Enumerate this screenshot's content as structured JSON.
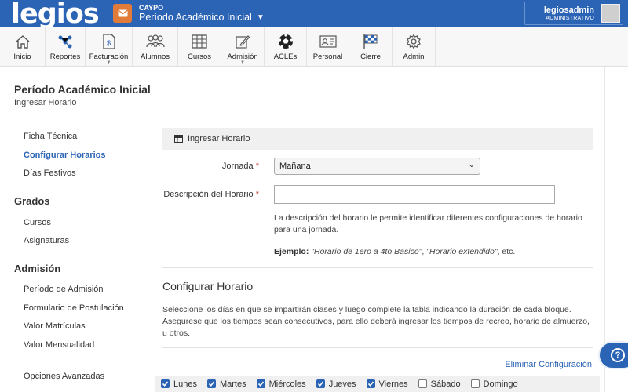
{
  "header": {
    "logo": "legios",
    "org_code": "CAYPO",
    "period": "Período Académico Inicial",
    "user_name": "legiosadmin",
    "user_role": "ADMINISTRATIVO"
  },
  "nav": {
    "items": [
      {
        "label": "Inicio",
        "icon": "home-icon"
      },
      {
        "label": "Reportes",
        "icon": "network-icon"
      },
      {
        "label": "Facturación",
        "icon": "invoice-icon"
      },
      {
        "label": "Alumnos",
        "icon": "students-icon"
      },
      {
        "label": "Cursos",
        "icon": "grid-icon"
      },
      {
        "label": "Admisión",
        "icon": "pencil-icon"
      },
      {
        "label": "ACLEs",
        "icon": "soccer-ball-icon"
      },
      {
        "label": "Personal",
        "icon": "id-card-icon"
      },
      {
        "label": "Cierre",
        "icon": "checkered-flag-icon"
      },
      {
        "label": "Admin",
        "icon": "gear-icon"
      }
    ]
  },
  "page": {
    "title": "Período Académico Inicial",
    "subtitle": "Ingresar Horario"
  },
  "sidebar": {
    "links_top": [
      "Ficha Técnica",
      "Configurar Horarios",
      "Días Festivos"
    ],
    "section_grados": "Grados",
    "links_grados": [
      "Cursos",
      "Asignaturas"
    ],
    "section_admision": "Admisión",
    "links_admision": [
      "Período de Admisión",
      "Formulario de Postulación",
      "Valor Matrículas",
      "Valor Mensualidad"
    ],
    "link_advanced": "Opciones Avanzadas"
  },
  "form": {
    "header": "Ingresar Horario",
    "jornada_label": "Jornada",
    "jornada_value": "Mañana",
    "descripcion_label": "Descripción del Horario",
    "required_mark": "*",
    "descripcion_value": "",
    "help": "La descripción del horario le permite identificar diferentes configuraciones de horario para una jornada.",
    "example_label": "Ejemplo:",
    "example_a": "\"Horario de 1ero a 4to Básico\"",
    "example_sep": ", ",
    "example_b": "\"Horario extendido\"",
    "example_tail": ", etc."
  },
  "config": {
    "title": "Configurar Horario",
    "desc": "Seleccione los días en que se impartirán clases y luego complete la tabla indicando la duración de cada bloque. Asegurese que los tiempos sean consecutivos, para ello deberá ingresar los tiempos de recreo, horario de almuerzo, u otros.",
    "delete_link": "Eliminar Configuración",
    "days": [
      {
        "label": "Lunes",
        "checked": true
      },
      {
        "label": "Martes",
        "checked": true
      },
      {
        "label": "Miércoles",
        "checked": true
      },
      {
        "label": "Jueves",
        "checked": true
      },
      {
        "label": "Viernes",
        "checked": true
      },
      {
        "label": "Sábado",
        "checked": false
      },
      {
        "label": "Domingo",
        "checked": false
      }
    ]
  },
  "help_button": "?",
  "colors": {
    "brand_blue": "#2b63b5",
    "mail_orange": "#e07b39",
    "required_red": "#c0392b"
  }
}
